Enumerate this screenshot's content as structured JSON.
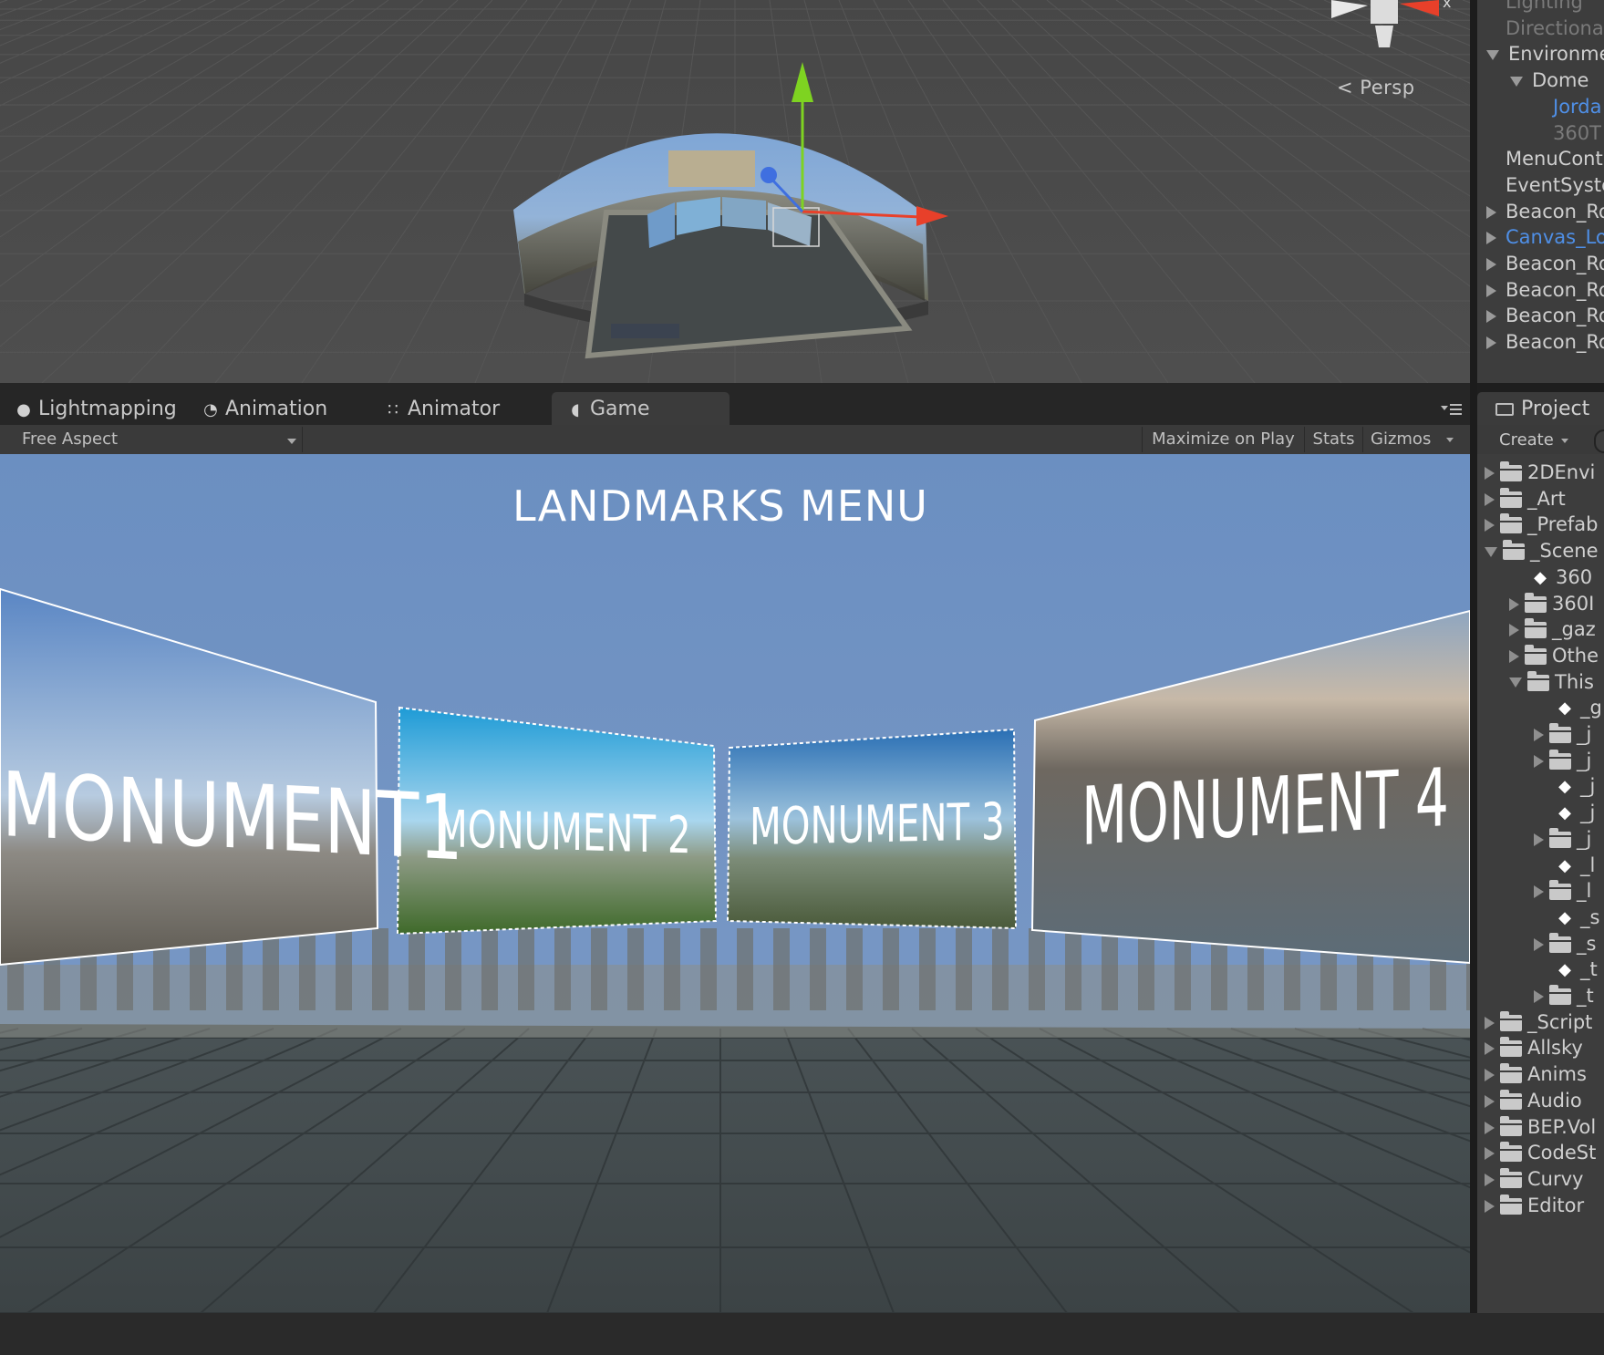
{
  "scene_view": {
    "camera_mode": "Persp",
    "gizmo_axis_label": "x"
  },
  "hierarchy": {
    "items": [
      {
        "label": "Lighting",
        "indent": 0,
        "arrow": "none",
        "style": "dim"
      },
      {
        "label": "Directiona",
        "indent": 0,
        "arrow": "none",
        "style": "dim"
      },
      {
        "label": "Environme",
        "indent": 0,
        "arrow": "down",
        "style": "normal"
      },
      {
        "label": "Dome",
        "indent": 1,
        "arrow": "down",
        "style": "normal"
      },
      {
        "label": "Jorda",
        "indent": 2,
        "arrow": "none",
        "style": "blue"
      },
      {
        "label": "360T",
        "indent": 2,
        "arrow": "none",
        "style": "dim"
      },
      {
        "label": "MenuCont",
        "indent": 0,
        "arrow": "none",
        "style": "normal"
      },
      {
        "label": "EventSyste",
        "indent": 0,
        "arrow": "none",
        "style": "normal"
      },
      {
        "label": "Beacon_Ro",
        "indent": 0,
        "arrow": "right",
        "style": "normal"
      },
      {
        "label": "Canvas_Lo",
        "indent": 0,
        "arrow": "right",
        "style": "blue"
      },
      {
        "label": "Beacon_Ro",
        "indent": 0,
        "arrow": "right",
        "style": "normal"
      },
      {
        "label": "Beacon_Ro",
        "indent": 0,
        "arrow": "right",
        "style": "normal"
      },
      {
        "label": "Beacon_Ro",
        "indent": 0,
        "arrow": "right",
        "style": "normal"
      },
      {
        "label": "Beacon_Ro",
        "indent": 0,
        "arrow": "right",
        "style": "normal"
      }
    ]
  },
  "tabs": [
    {
      "label": "Lightmapping",
      "icon": "lightbulb-icon",
      "active": false
    },
    {
      "label": "Animation",
      "icon": "clock-icon",
      "active": false
    },
    {
      "label": "Animator",
      "icon": "animator-grid-icon",
      "active": false
    },
    {
      "label": "Game",
      "icon": "game-pacman-icon",
      "active": true
    }
  ],
  "game_toolbar": {
    "aspect": "Free Aspect",
    "maximize_on_play": "Maximize on Play",
    "stats": "Stats",
    "gizmos": "Gizmos"
  },
  "game_view": {
    "title": "LANDMARKS MENU",
    "panels": [
      "MONUMENT1",
      "MONUMENT 2",
      "MONUMENT 3",
      "MONUMENT 4"
    ]
  },
  "project": {
    "tab_label": "Project",
    "create_label": "Create",
    "items": [
      {
        "label": "2DEnvi",
        "depth": 0,
        "arrow": "right",
        "kind": "folder"
      },
      {
        "label": "_Art",
        "depth": 0,
        "arrow": "right",
        "kind": "folder"
      },
      {
        "label": "_Prefab",
        "depth": 0,
        "arrow": "right",
        "kind": "folder"
      },
      {
        "label": "_Scene",
        "depth": 0,
        "arrow": "down",
        "kind": "folder"
      },
      {
        "label": "360",
        "depth": 1,
        "arrow": "none",
        "kind": "scene"
      },
      {
        "label": "360I",
        "depth": 1,
        "arrow": "right",
        "kind": "folder"
      },
      {
        "label": "_gaz",
        "depth": 1,
        "arrow": "right",
        "kind": "folder"
      },
      {
        "label": "Othe",
        "depth": 1,
        "arrow": "right",
        "kind": "folder"
      },
      {
        "label": "This",
        "depth": 1,
        "arrow": "down",
        "kind": "folder"
      },
      {
        "label": "_g",
        "depth": 2,
        "arrow": "none",
        "kind": "scene"
      },
      {
        "label": "_j",
        "depth": 2,
        "arrow": "right",
        "kind": "folder"
      },
      {
        "label": "_j",
        "depth": 2,
        "arrow": "right",
        "kind": "folder"
      },
      {
        "label": "_j",
        "depth": 2,
        "arrow": "none",
        "kind": "scene"
      },
      {
        "label": "_j",
        "depth": 2,
        "arrow": "none",
        "kind": "scene"
      },
      {
        "label": "_j",
        "depth": 2,
        "arrow": "right",
        "kind": "folder"
      },
      {
        "label": "_l",
        "depth": 2,
        "arrow": "none",
        "kind": "scene"
      },
      {
        "label": "_l",
        "depth": 2,
        "arrow": "right",
        "kind": "folder"
      },
      {
        "label": "_s",
        "depth": 2,
        "arrow": "none",
        "kind": "scene"
      },
      {
        "label": "_s",
        "depth": 2,
        "arrow": "right",
        "kind": "folder"
      },
      {
        "label": "_t",
        "depth": 2,
        "arrow": "none",
        "kind": "scene"
      },
      {
        "label": "_t",
        "depth": 2,
        "arrow": "right",
        "kind": "folder"
      },
      {
        "label": "_Script",
        "depth": 0,
        "arrow": "right",
        "kind": "folder"
      },
      {
        "label": "Allsky",
        "depth": 0,
        "arrow": "right",
        "kind": "folder"
      },
      {
        "label": "Anims",
        "depth": 0,
        "arrow": "right",
        "kind": "folder"
      },
      {
        "label": "Audio",
        "depth": 0,
        "arrow": "right",
        "kind": "folder"
      },
      {
        "label": "BEP.Vol",
        "depth": 0,
        "arrow": "right",
        "kind": "folder"
      },
      {
        "label": "CodeSt",
        "depth": 0,
        "arrow": "right",
        "kind": "folder"
      },
      {
        "label": "Curvy",
        "depth": 0,
        "arrow": "right",
        "kind": "folder"
      },
      {
        "label": "Editor",
        "depth": 0,
        "arrow": "right",
        "kind": "folder"
      }
    ]
  },
  "colors": {
    "editor_bg": "#3d3d3d",
    "scene_bg": "#4a4a4a",
    "sky": "#6f93c4",
    "selection_blue": "#4f8fe6",
    "gizmo_y": "#7ed321",
    "gizmo_x": "#e8402a",
    "gizmo_z": "#3f6fe0"
  }
}
